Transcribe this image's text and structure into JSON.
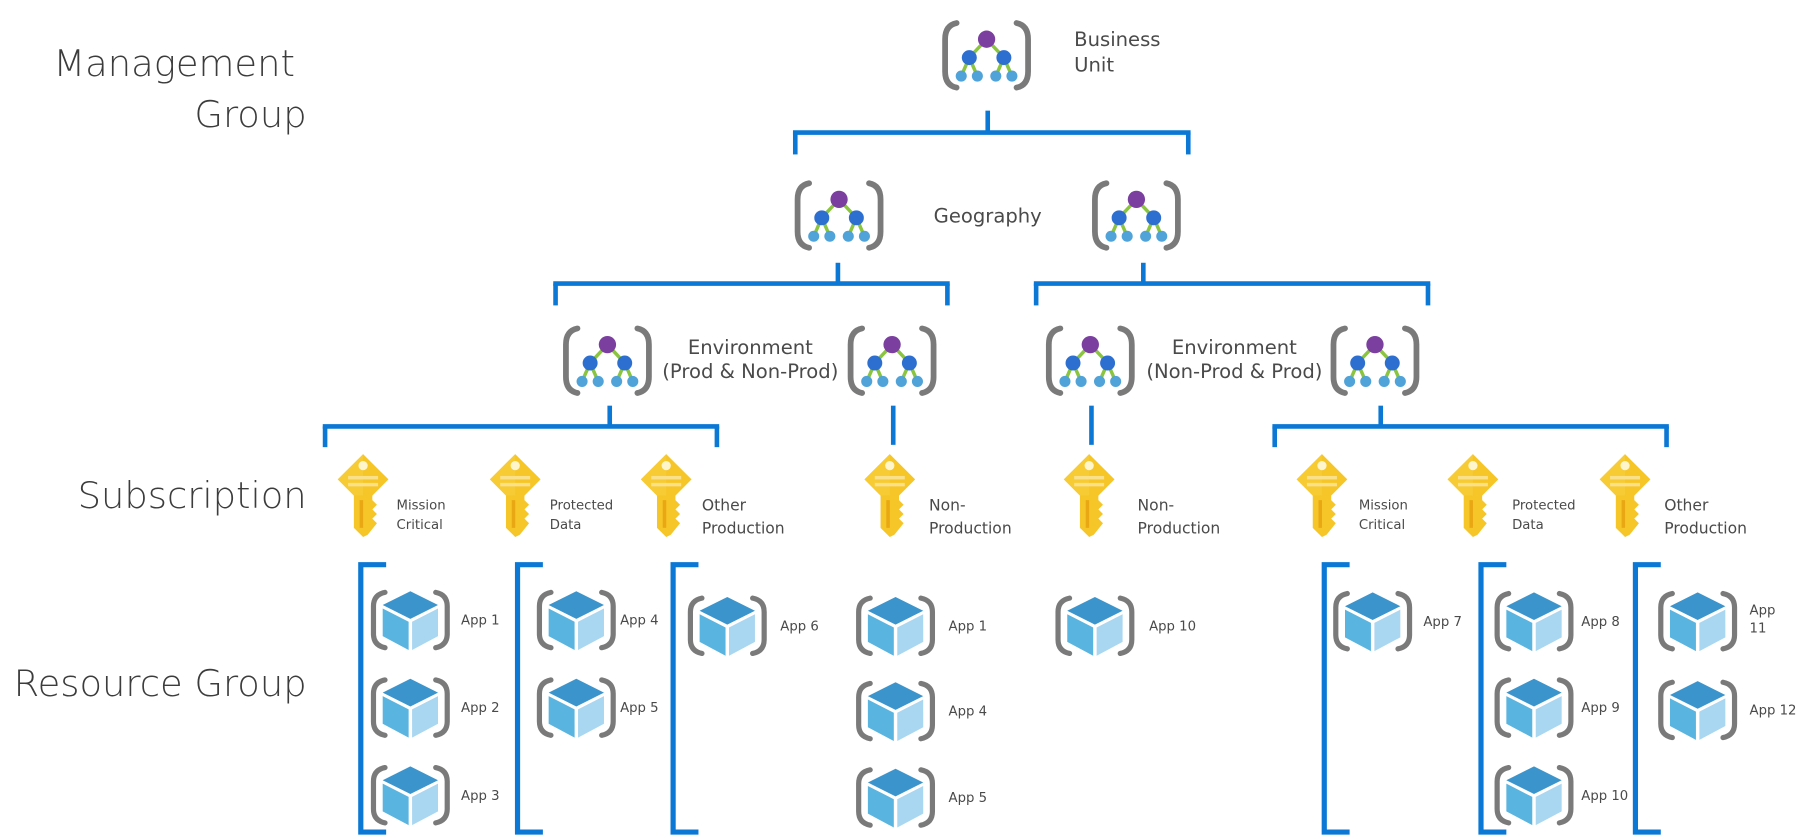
{
  "tiers": {
    "management_group": [
      "Management",
      "Group"
    ],
    "subscription": "Subscription",
    "resource_group": "Resource Group"
  },
  "colors": {
    "connector": "#0a78d4",
    "mg_root_node": "#7b3fa0",
    "mg_mid_node": "#2d6fd1",
    "mg_leaf_node": "#4fa3d8",
    "mg_link": "#8bc53f",
    "bracket_gray": "#7a7a7a",
    "key_gold": "#f6c528",
    "cube_top": "#3c94cc",
    "cube_left": "#5ab4e0",
    "cube_right": "#a9d6f0"
  },
  "management_groups": {
    "business_unit": {
      "icon": "management-group-icon",
      "label": [
        "Business",
        "Unit"
      ]
    },
    "geography": {
      "icon": "management-group-icon",
      "label": [
        "Geography"
      ],
      "count": 2
    },
    "environment_left": {
      "icon": "management-group-icon",
      "label": [
        "Environment",
        "(Prod & Non-Prod)"
      ],
      "count": 2
    },
    "environment_right": {
      "icon": "management-group-icon",
      "label": [
        "Environment",
        "(Non-Prod & Prod)"
      ],
      "count": 2
    }
  },
  "subscriptions": [
    {
      "icon": "key-icon",
      "label": [
        "Mission",
        "Critical"
      ]
    },
    {
      "icon": "key-icon",
      "label": [
        "Protected",
        "Data"
      ]
    },
    {
      "icon": "key-icon",
      "label": [
        "Other",
        "Production"
      ]
    },
    {
      "icon": "key-icon",
      "label": [
        "Non-",
        "Production"
      ]
    },
    {
      "icon": "key-icon",
      "label": [
        "Non-",
        "Production"
      ]
    },
    {
      "icon": "key-icon",
      "label": [
        "Mission",
        "Critical"
      ]
    },
    {
      "icon": "key-icon",
      "label": [
        "Protected",
        "Data"
      ]
    },
    {
      "icon": "key-icon",
      "label": [
        "Other",
        "Production"
      ]
    }
  ],
  "resource_groups": [
    {
      "bracket": true,
      "apps": [
        "App 1",
        "App 2",
        "App 3"
      ]
    },
    {
      "bracket": true,
      "apps": [
        "App 4",
        "App 5"
      ]
    },
    {
      "bracket": true,
      "apps": [
        "App 6"
      ]
    },
    {
      "bracket": false,
      "apps": [
        "App 1",
        "App 4",
        "App 5"
      ]
    },
    {
      "bracket": false,
      "apps": [
        "App 10"
      ]
    },
    {
      "bracket": true,
      "apps": [
        "App 7"
      ]
    },
    {
      "bracket": true,
      "apps": [
        "App 8",
        "App 9",
        "App 10"
      ]
    },
    {
      "bracket": true,
      "apps": [
        [
          "App",
          "11"
        ],
        "App 12"
      ]
    }
  ]
}
